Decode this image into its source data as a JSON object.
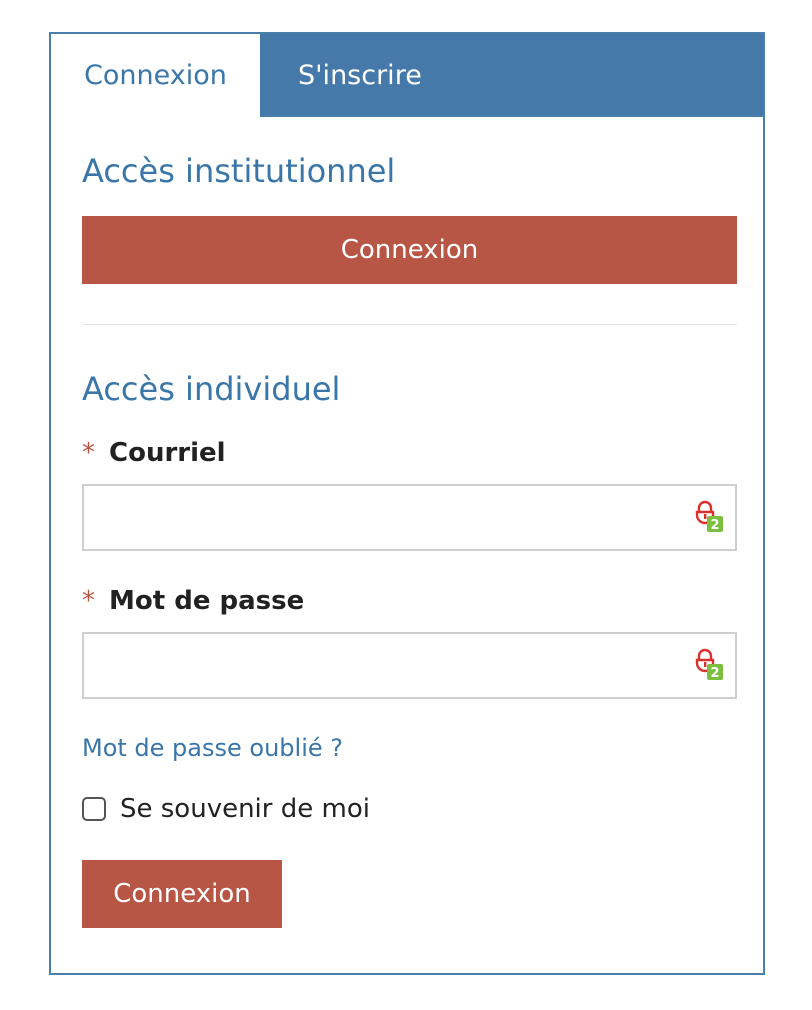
{
  "tabs": {
    "login": "Connexion",
    "register": "S'inscrire"
  },
  "institutional": {
    "heading": "Accès institutionnel",
    "button_label": "Connexion"
  },
  "individual": {
    "heading": "Accès individuel",
    "email": {
      "required_mark": "*",
      "label": "Courriel",
      "value": "",
      "placeholder": ""
    },
    "password": {
      "required_mark": "*",
      "label": "Mot de passe",
      "value": "",
      "placeholder": ""
    },
    "password_manager_badge_count": "2",
    "forgot_link": "Mot de passe oublié ?",
    "remember_me": {
      "label": "Se souvenir de moi",
      "checked": false
    },
    "submit_label": "Connexion"
  },
  "colors": {
    "accent_blue": "#4479aa",
    "button_red": "#b85646",
    "badge_green": "#7cbf3f",
    "lock_red": "#d9322e"
  },
  "icons": {
    "password_manager": "lock-badge-icon"
  }
}
